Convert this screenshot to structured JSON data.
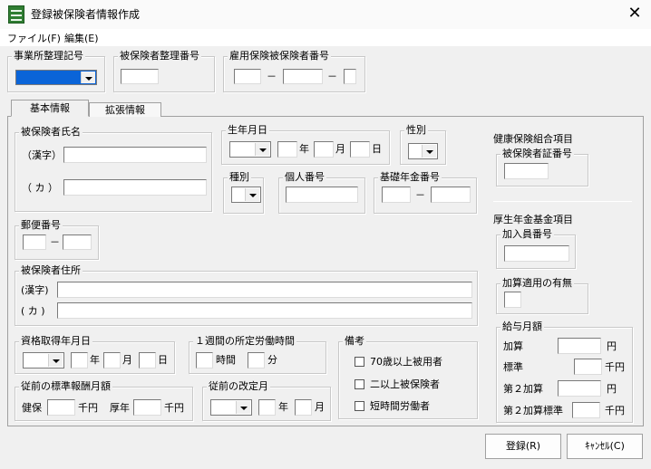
{
  "window": {
    "title": "登録被保険者情報作成",
    "close": "✕"
  },
  "menu": {
    "file": "ファイル(F)",
    "edit": "編集(E)"
  },
  "top": {
    "jigyosho_label": "事業所整理記号",
    "hihoken_seiri_label": "被保険者整理番号",
    "koyo_label": "雇用保険被保険者番号",
    "dash": "－"
  },
  "tabs": {
    "basic": "基本情報",
    "extended": "拡張情報"
  },
  "name": {
    "group": "被保険者氏名",
    "kanji": "（漢字）",
    "kana": "（ カ ）"
  },
  "birth": {
    "group": "生年月日",
    "year": "年",
    "month": "月",
    "day": "日"
  },
  "gender": {
    "group": "性別"
  },
  "kind": {
    "group": "種別"
  },
  "kojin": {
    "group": "個人番号"
  },
  "kiso": {
    "group": "基礎年金番号",
    "dash": "－"
  },
  "postal": {
    "group": "郵便番号",
    "dash": "－"
  },
  "address": {
    "group": "被保険者住所",
    "kanji": "(漢字)",
    "kana": "( カ )"
  },
  "shikaku": {
    "group": "資格取得年月日",
    "year": "年",
    "month": "月",
    "day": "日"
  },
  "weekly": {
    "group": "１週間の所定労働時間",
    "hours": "時間",
    "minutes": "分"
  },
  "notes": {
    "group": "備考",
    "items": [
      "70歳以上被用者",
      "二以上被保険者",
      "短時間労働者"
    ]
  },
  "prev_wage": {
    "group": "従前の標準報酬月額",
    "kenpo": "健保",
    "kosei": "厚年",
    "unit": "千円"
  },
  "prev_revision": {
    "group": "従前の改定月",
    "year": "年",
    "month": "月"
  },
  "kenpo_kumiai": {
    "title": "健康保険組合項目",
    "group": "被保険者証番号"
  },
  "kosei_kikin": {
    "title": "厚生年金基金項目",
    "member_group": "加入員番号",
    "kasan_group": "加算適用の有無",
    "salary": {
      "group": "給与月額",
      "rows": [
        {
          "label": "加算",
          "unit": "円"
        },
        {
          "label": "標準",
          "unit": "千円"
        },
        {
          "label": "第２加算",
          "unit": "円"
        },
        {
          "label": "第２加算標準",
          "unit": "千円"
        }
      ]
    }
  },
  "buttons": {
    "register": "登録(R)",
    "cancel": "ｷｬﾝｾﾙ(C)"
  }
}
